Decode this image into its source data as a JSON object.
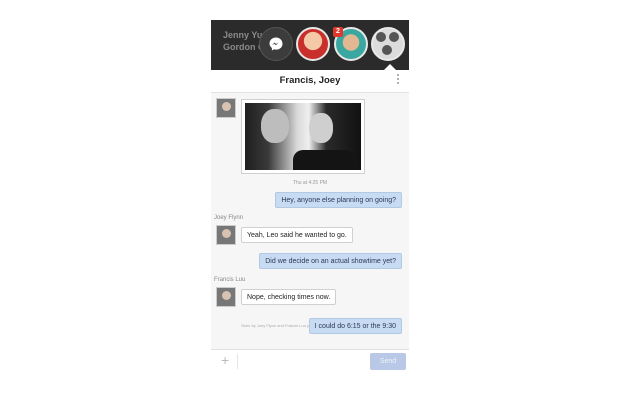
{
  "chat_heads": {
    "background_text": [
      "Jenny Yua",
      "Gordon C"
    ],
    "badge_count": "2"
  },
  "header": {
    "title": "Francis, Joey"
  },
  "conversation": {
    "timestamp": "Thu at 4:25 PM",
    "messages": [
      {
        "text": "Hey, anyone else planning on going?"
      },
      {
        "sender": "Joey Flynn",
        "text": "Yeah, Leo said he wanted to go."
      },
      {
        "text": "Did we decide on an actual showtime yet?"
      },
      {
        "sender": "Francis Luu",
        "text": "Nope, checking times now."
      },
      {
        "text": "I could do 6:15 or the 9:30"
      }
    ],
    "seen_note": "Seen by Joey Flynn and Francis Luu just now"
  },
  "composer": {
    "send_label": "Send",
    "add_icon": "plus-icon"
  },
  "colors": {
    "outgoing_bubble": "#c7dbf3",
    "send_button": "#b9c8e6",
    "badge": "#e0392b"
  }
}
